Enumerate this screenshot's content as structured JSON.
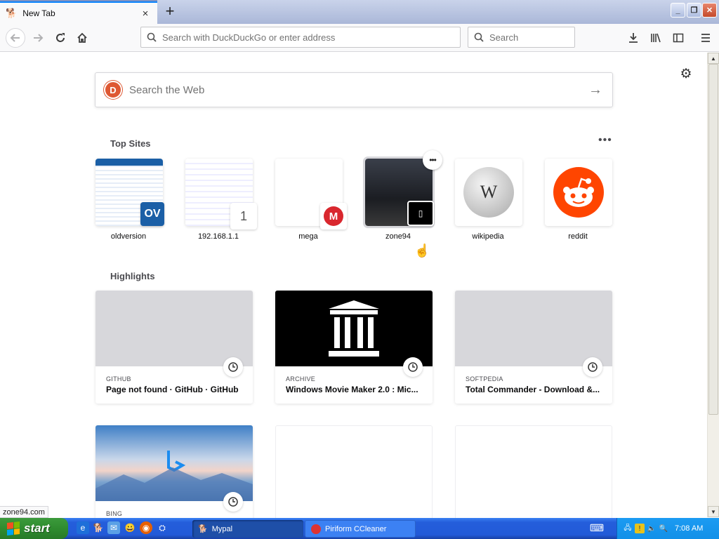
{
  "browser": {
    "tab": {
      "title": "New Tab",
      "close": "×"
    },
    "new_tab": "+",
    "window_controls": {
      "minimize": "_",
      "restore": "❐",
      "close": "✕"
    },
    "urlbar_placeholder": "Search with DuckDuckGo or enter address",
    "searchbar_placeholder": "Search",
    "status_text": "zone94.com"
  },
  "page": {
    "websearch_placeholder": "Search the Web",
    "top_sites_title": "Top Sites",
    "top_sites": [
      {
        "label": "oldversion",
        "icon": "OV",
        "color": "#1b5fa6"
      },
      {
        "label": "192.168.1.1",
        "icon": "1",
        "color": "#ffffff"
      },
      {
        "label": "mega",
        "icon": "M",
        "color": "#d9272e"
      },
      {
        "label": "zone94",
        "icon": "▯",
        "color": "#000000"
      },
      {
        "label": "wikipedia",
        "icon": "W",
        "color": "#c8c8c8"
      },
      {
        "label": "reddit",
        "icon": "reddit-alien",
        "color": "#ff4500"
      }
    ],
    "highlights_title": "Highlights",
    "highlights": [
      {
        "source": "GITHUB",
        "title": "Page not found · GitHub · GitHub"
      },
      {
        "source": "ARCHIVE",
        "title": "Windows Movie Maker 2.0 : Mic..."
      },
      {
        "source": "SOFTPEDIA",
        "title": "Total Commander - Download &..."
      },
      {
        "source": "BING",
        "title": ""
      }
    ]
  },
  "taskbar": {
    "start_label": "start",
    "tasks": [
      {
        "label": "Mypal",
        "active": true
      },
      {
        "label": "Piriform CCleaner",
        "active": false
      }
    ],
    "clock": "7:08 AM"
  },
  "colors": {
    "accent": "#0a84ff",
    "taskbar": "#245edb",
    "start": "#2f8c2f",
    "reddit": "#ff4500",
    "ddg": "#de5833"
  }
}
